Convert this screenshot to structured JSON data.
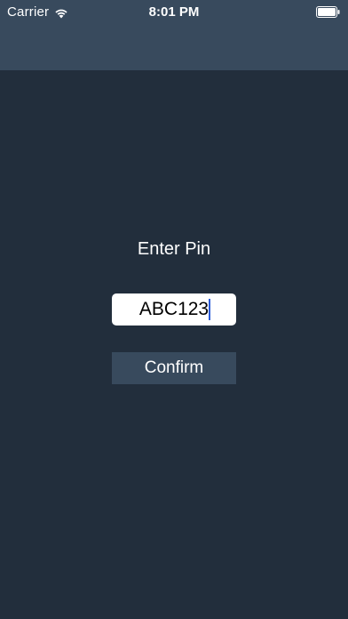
{
  "status_bar": {
    "carrier": "Carrier",
    "time": "8:01 PM",
    "icons": [
      "wifi-icon",
      "battery-icon"
    ]
  },
  "main": {
    "prompt": "Enter Pin",
    "pin_value": "ABC123",
    "confirm_label": "Confirm"
  },
  "colors": {
    "background": "#222e3c",
    "nav_bar": "#384a5d",
    "button": "#384a5d",
    "input_background": "#ffffff",
    "caret": "#2a5bd7",
    "text": "#ffffff"
  }
}
